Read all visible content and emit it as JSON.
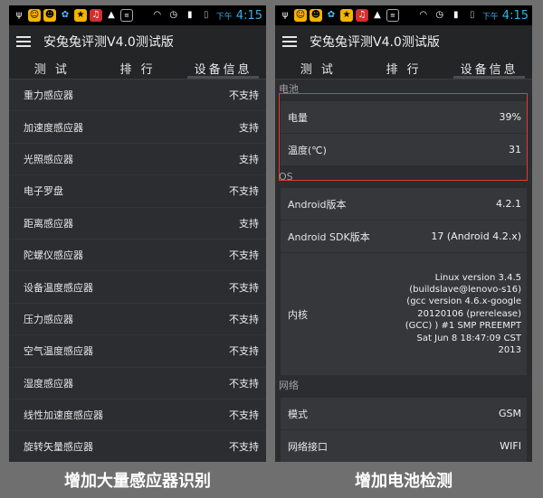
{
  "app_title": "安兔兔评测V4.0测试版",
  "status": {
    "ampm": "下午",
    "time": "4:15"
  },
  "tabs": [
    "测 试",
    "排 行",
    "设备信息"
  ],
  "sensors": [
    {
      "name": "重力感应器",
      "value": "不支持"
    },
    {
      "name": "加速度感应器",
      "value": "支持"
    },
    {
      "name": "光照感应器",
      "value": "支持"
    },
    {
      "name": "电子罗盘",
      "value": "不支持"
    },
    {
      "name": "距离感应器",
      "value": "支持"
    },
    {
      "name": "陀螺仪感应器",
      "value": "不支持"
    },
    {
      "name": "设备温度感应器",
      "value": "不支持"
    },
    {
      "name": "压力感应器",
      "value": "不支持"
    },
    {
      "name": "空气温度感应器",
      "value": "不支持"
    },
    {
      "name": "湿度感应器",
      "value": "不支持"
    },
    {
      "name": "线性加速度感应器",
      "value": "不支持"
    },
    {
      "name": "旋转矢量感应器",
      "value": "不支持"
    }
  ],
  "battery": {
    "header": "电池",
    "rows": [
      {
        "label": "电量",
        "value": "39%"
      },
      {
        "label": "温度(℃)",
        "value": "31"
      }
    ]
  },
  "os": {
    "header": "OS",
    "rows": [
      {
        "label": "Android版本",
        "value": "4.2.1"
      },
      {
        "label": "Android SDK版本",
        "value": "17  (Android 4.2.x)"
      },
      {
        "label": "内核",
        "value": "Linux version 3.4.5 (buildslave@lenovo-s16) (gcc version 4.6.x-google 20120106 (prerelease) (GCC) ) #1 SMP PREEMPT Sat Jun 8 18:47:09 CST 2013"
      }
    ]
  },
  "network": {
    "header": "网络",
    "rows": [
      {
        "label": "模式",
        "value": "GSM"
      },
      {
        "label": "网络接口",
        "value": "WIFI"
      }
    ]
  },
  "captions": {
    "left": "增加大量感应器识别",
    "right": "增加电池检测"
  },
  "colors": {
    "highlight": "#e53935",
    "clock": "#33b5e5"
  }
}
